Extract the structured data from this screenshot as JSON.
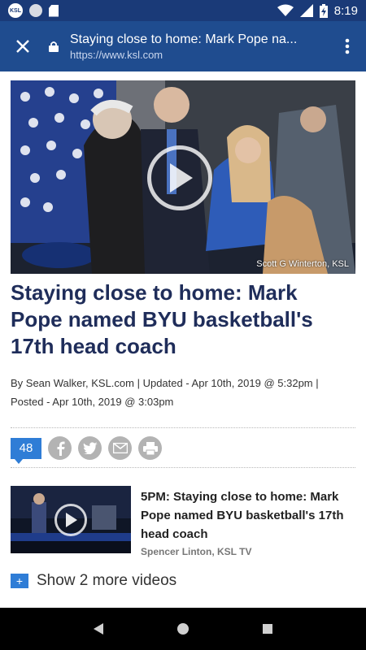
{
  "status_bar": {
    "time": "8:19",
    "app_badge": "KSL",
    "icons": [
      "ksl-app-icon",
      "circle-app-icon",
      "sd-card-icon",
      "wifi-icon",
      "signal-icon",
      "battery-charging-icon"
    ]
  },
  "toolbar": {
    "page_title": "Staying close to home: Mark Pope na...",
    "url": "https://www.ksl.com",
    "icons": [
      "close-icon",
      "lock-icon",
      "more-vert-icon"
    ]
  },
  "article": {
    "photo_credit": "Scott G Winterton, KSL",
    "headline": "Staying close to home: Mark Pope named BYU basketball's 17th head coach",
    "byline_1": "By Sean Walker, KSL.com | Updated - Apr 10th, 2019 @ 5:32pm |",
    "byline_2": "Posted - Apr 10th, 2019 @ 3:03pm",
    "comment_count": "48",
    "share_icons": [
      "facebook-icon",
      "twitter-icon",
      "email-icon",
      "print-icon"
    ]
  },
  "video": {
    "title": "5PM: Staying close to home: Mark Pope named BYU basketball's 17th head coach",
    "author": "Spencer Linton, KSL TV",
    "more_label": "Show 2 more videos"
  },
  "colors": {
    "status_bar": "#1a3a78",
    "toolbar": "#1f4c8f",
    "headline": "#1f2d5a",
    "accent": "#2f7dd6"
  }
}
